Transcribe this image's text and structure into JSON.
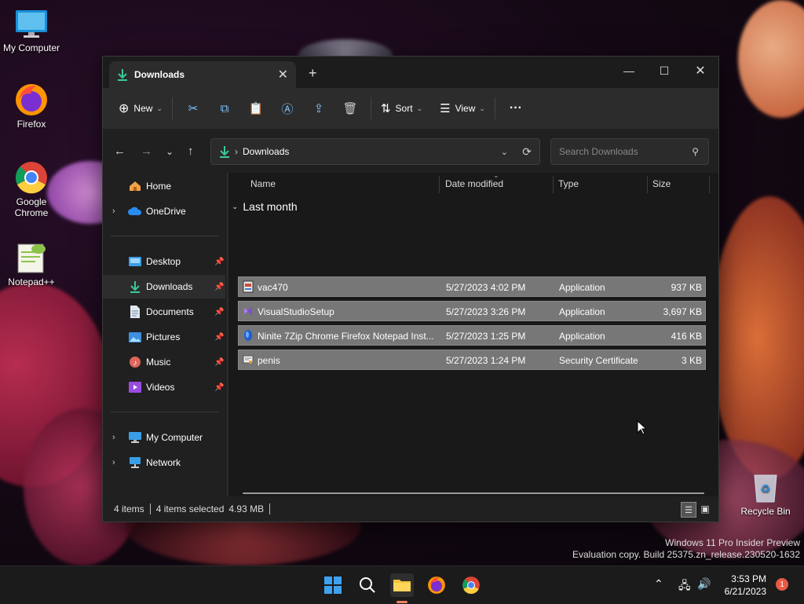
{
  "desktop": {
    "icons": [
      {
        "label": "My Computer"
      },
      {
        "label": "Firefox"
      },
      {
        "label": "Google Chrome"
      },
      {
        "label": "Notepad++"
      },
      {
        "label": "Recycle Bin"
      }
    ],
    "watermark": {
      "line1": "Windows 11 Pro Insider Preview",
      "line2": "Evaluation copy. Build 25375.zn_release.230520-1632"
    }
  },
  "explorer": {
    "tab": {
      "title": "Downloads",
      "close": "✕"
    },
    "new_tab": "+",
    "window_controls": {
      "minimize": "—",
      "maximize": "☐",
      "close": "✕"
    },
    "toolbar": {
      "new_label": "New",
      "sort_label": "Sort",
      "view_label": "View",
      "more": "···"
    },
    "address": {
      "path": "Downloads",
      "separator": "›"
    },
    "search": {
      "placeholder": "Search Downloads"
    },
    "nav": {
      "home": "Home",
      "onedrive": "OneDrive",
      "desktop": "Desktop",
      "downloads": "Downloads",
      "documents": "Documents",
      "pictures": "Pictures",
      "music": "Music",
      "videos": "Videos",
      "my_computer": "My Computer",
      "network": "Network"
    },
    "columns": {
      "name": "Name",
      "date": "Date modified",
      "type": "Type",
      "size": "Size"
    },
    "group": "Last month",
    "files": [
      {
        "name": "vac470",
        "date": "5/27/2023 4:02 PM",
        "type": "Application",
        "size": "937 KB"
      },
      {
        "name": "VisualStudioSetup",
        "date": "5/27/2023 3:26 PM",
        "type": "Application",
        "size": "3,697 KB"
      },
      {
        "name": "Ninite 7Zip Chrome Firefox Notepad Inst...",
        "date": "5/27/2023 1:25 PM",
        "type": "Application",
        "size": "416 KB"
      },
      {
        "name": "penis",
        "date": "5/27/2023 1:24 PM",
        "type": "Security Certificate",
        "size": "3 KB"
      }
    ],
    "status": {
      "count": "4 items",
      "selected": "4 items selected",
      "size": "4.93 MB"
    }
  },
  "taskbar": {
    "time": "3:53 PM",
    "date": "6/21/2023",
    "notifications": "1"
  }
}
